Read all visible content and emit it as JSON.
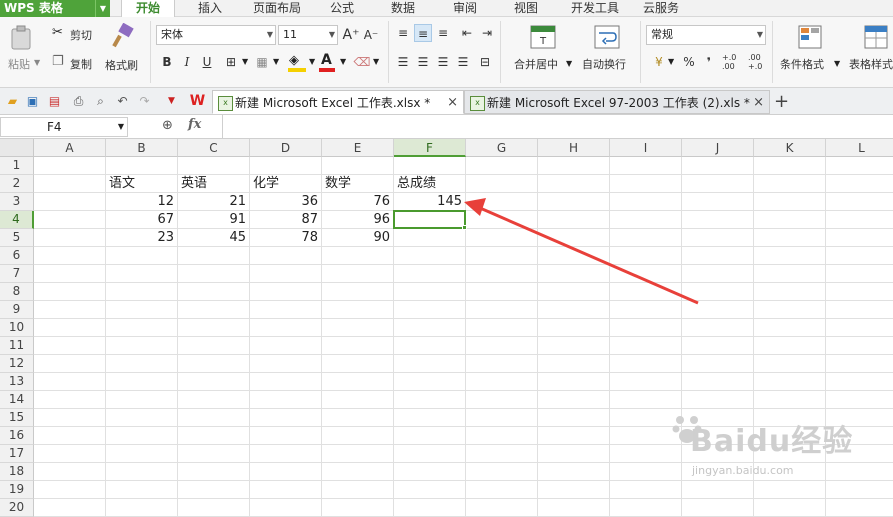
{
  "app": {
    "title": "WPS 表格"
  },
  "menu": {
    "tabs": [
      "开始",
      "插入",
      "页面布局",
      "公式",
      "数据",
      "审阅",
      "视图",
      "开发工具",
      "云服务"
    ],
    "active": 0
  },
  "ribbon": {
    "clipboard": {
      "paste": "粘贴",
      "cut": "剪切",
      "copy": "复制",
      "format_painter": "格式刷"
    },
    "font": {
      "name": "宋体",
      "size": "11",
      "bold": "B",
      "italic": "I",
      "underline": "U",
      "font_color": "A"
    },
    "alignment": {
      "merge_center": "合并居中",
      "wrap_text": "自动换行"
    },
    "number": {
      "format": "常规",
      "percent": "%",
      "comma": "❜",
      "inc_decimal": "+.0 .00",
      "dec_decimal": ".00 +.0"
    },
    "styles": {
      "conditional_format": "条件格式",
      "table_style": "表格样式"
    }
  },
  "tabs": [
    {
      "name": "新建 Microsoft Excel 工作表.xlsx *",
      "active": true
    },
    {
      "name": "新建 Microsoft Excel 97-2003 工作表 (2).xls *",
      "active": false
    }
  ],
  "new_tab_label": "+",
  "formula_bar": {
    "name_box": "F4",
    "fx_label": "fx",
    "formula": ""
  },
  "sheet": {
    "columns": [
      "A",
      "B",
      "C",
      "D",
      "E",
      "F",
      "G",
      "H",
      "I",
      "J",
      "K",
      "L"
    ],
    "rows": [
      "1",
      "2",
      "3",
      "4",
      "5",
      "6",
      "7",
      "8",
      "9",
      "10",
      "11",
      "12",
      "13",
      "14",
      "15",
      "16",
      "17",
      "18",
      "19",
      "20"
    ],
    "selected_cell": "F4",
    "headers": {
      "B2": "语文",
      "C2": "英语",
      "D2": "化学",
      "E2": "数学",
      "F2": "总成绩"
    },
    "values": {
      "B3": "12",
      "C3": "21",
      "D3": "36",
      "E3": "76",
      "F3": "145",
      "B4": "67",
      "C4": "91",
      "D4": "87",
      "E4": "96",
      "B5": "23",
      "C5": "45",
      "D5": "78",
      "E5": "90"
    }
  },
  "annotation": {
    "color": "#e8403a"
  },
  "watermark": {
    "text": "Baidu经验",
    "url": "jingyan.baidu.com"
  },
  "colors": {
    "accent": "#4fa33a",
    "selection": "#4a9a2e"
  }
}
